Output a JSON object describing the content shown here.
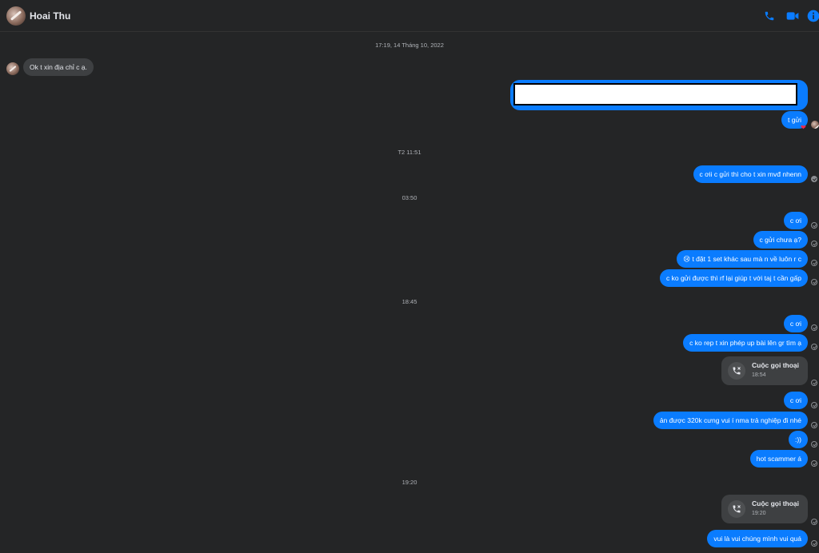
{
  "header": {
    "contact_name": "Hoai Thu",
    "icons": [
      "phone-icon",
      "video-icon",
      "info-icon"
    ],
    "accent_color": "#0a7cff"
  },
  "timestamps": {
    "t1": "17:19, 14 Tháng 10, 2022",
    "t2": "T2 11:51",
    "t3": "03:50",
    "t4": "18:45",
    "t5": "19:20"
  },
  "messages": {
    "m1": "Ok t xin địa chỉ c ạ.",
    "m2": "t gửi",
    "m3": "c ơii c gửi thì cho t xin mvđ nhenn",
    "m4": "c ơi",
    "m5": "c gửi chưa ạ?",
    "m6": "t đặt 1 set khác sau mà n về luôn r c",
    "m6_emoji": "😢",
    "m7": "c ko gửi được thì rf lại giúp t với taj t cần gấp",
    "m8": "c ơi",
    "m9": "c ko rep t xin phép up bài lên gr tìm ạ",
    "m10": "c ơi",
    "m11": "ản được 320k cưng vui í nma trả nghiệp đi nhé",
    "m12": ":))",
    "m13": "hot scammer á",
    "m14": "vui là vui chúng mình vui quá",
    "reaction": "❤"
  },
  "calls": {
    "c1": {
      "title": "Cuộc gọi thoại",
      "time": "18:54"
    },
    "c2": {
      "title": "Cuộc gọi thoại",
      "time": "19:20"
    }
  }
}
